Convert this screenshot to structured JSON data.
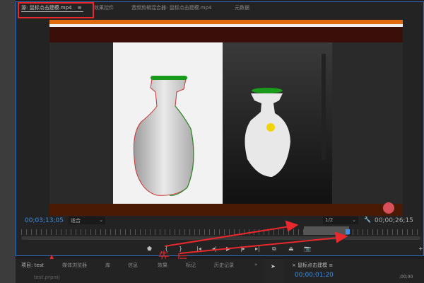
{
  "tabs": [
    "源: 鼠标点击建模.mp4",
    "效果控件",
    "音频剪辑混合器: 鼠标点击建模.mp4",
    "元数据"
  ],
  "tab_menu_icon": "≡",
  "source": {
    "timecode_in": "00;03;13;05",
    "fit": "适合",
    "resolution": "1/2",
    "duration": "00;00;26;15"
  },
  "annotations": {
    "first": "先",
    "then": "后"
  },
  "bottom_tabs": [
    "项目: test",
    "媒体浏览器",
    "库",
    "信息",
    "效果",
    "标记",
    "历史记录"
  ],
  "project_file": "test.prproj",
  "program": {
    "title": "鼠标点击建模",
    "timecode": "00;00;01;20",
    "ruler": ";00;00"
  },
  "colors": {
    "accent": "#3d8ee6",
    "annotation": "#e8282d",
    "panel_border": "#2d6cc0"
  }
}
